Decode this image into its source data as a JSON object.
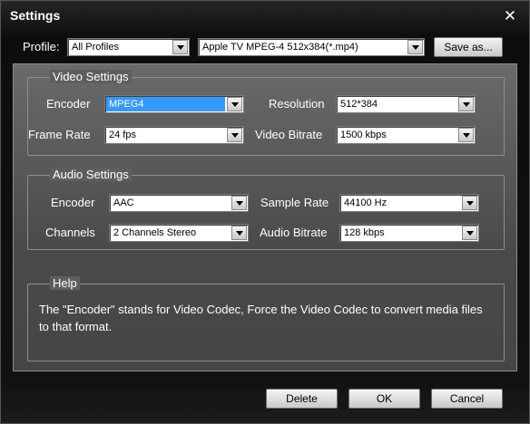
{
  "window": {
    "title": "Settings",
    "close_glyph": "✕"
  },
  "profile": {
    "label": "Profile:",
    "category": "All Profiles",
    "preset": "Apple TV MPEG-4 512x384(*.mp4)",
    "save_as_label": "Save as..."
  },
  "video": {
    "title": "Video Settings",
    "encoder_label": "Encoder",
    "encoder_value": "MPEG4",
    "resolution_label": "Resolution",
    "resolution_value": "512*384",
    "frame_rate_label": "Frame Rate",
    "frame_rate_value": "24 fps",
    "bitrate_label": "Video Bitrate",
    "bitrate_value": "1500 kbps"
  },
  "audio": {
    "title": "Audio Settings",
    "encoder_label": "Encoder",
    "encoder_value": "AAC",
    "sample_rate_label": "Sample Rate",
    "sample_rate_value": "44100 Hz",
    "channels_label": "Channels",
    "channels_value": "2 Channels Stereo",
    "bitrate_label": "Audio Bitrate",
    "bitrate_value": "128 kbps"
  },
  "help": {
    "title": "Help",
    "text": "The \"Encoder\" stands for Video Codec, Force the Video Codec to convert media files to that format."
  },
  "footer": {
    "delete_label": "Delete",
    "ok_label": "OK",
    "cancel_label": "Cancel"
  },
  "icons": {
    "close": "close-icon",
    "dropdown": "chevron-down-icon"
  },
  "colors": {
    "selection": "#3399ff",
    "panel": "#5a5a5a",
    "window": "#111111"
  }
}
